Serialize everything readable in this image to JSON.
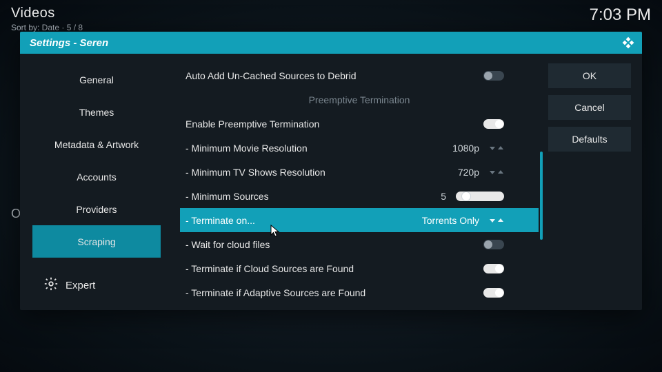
{
  "top": {
    "title": "Videos",
    "sub": "Sort by: Date  ·  5 / 8",
    "clock": "7:03 PM"
  },
  "dialog": {
    "title": "Settings - Seren"
  },
  "sidebar": {
    "categories": [
      "General",
      "Themes",
      "Metadata & Artwork",
      "Accounts",
      "Providers",
      "Scraping"
    ],
    "active_index": 5,
    "level_label": "Expert"
  },
  "rows": {
    "auto_add": {
      "label": "Auto Add Un-Cached Sources to Debrid"
    },
    "section_preemptive": "Preemptive Termination",
    "enable_preemptive": {
      "label": "Enable Preemptive Termination"
    },
    "min_movie": {
      "label": "- Minimum Movie Resolution",
      "value": "1080p"
    },
    "min_tv": {
      "label": "- Minimum TV Shows Resolution",
      "value": "720p"
    },
    "min_sources": {
      "label": "- Minimum Sources",
      "value": "5"
    },
    "terminate_on": {
      "label": "- Terminate on...",
      "value": "Torrents Only"
    },
    "wait_cloud": {
      "label": "- Wait for cloud files"
    },
    "term_cloud": {
      "label": "- Terminate if Cloud Sources are Found"
    },
    "term_adaptive": {
      "label": "- Terminate if Adaptive Sources are Found"
    }
  },
  "actions": {
    "ok": "OK",
    "cancel": "Cancel",
    "defaults": "Defaults"
  }
}
